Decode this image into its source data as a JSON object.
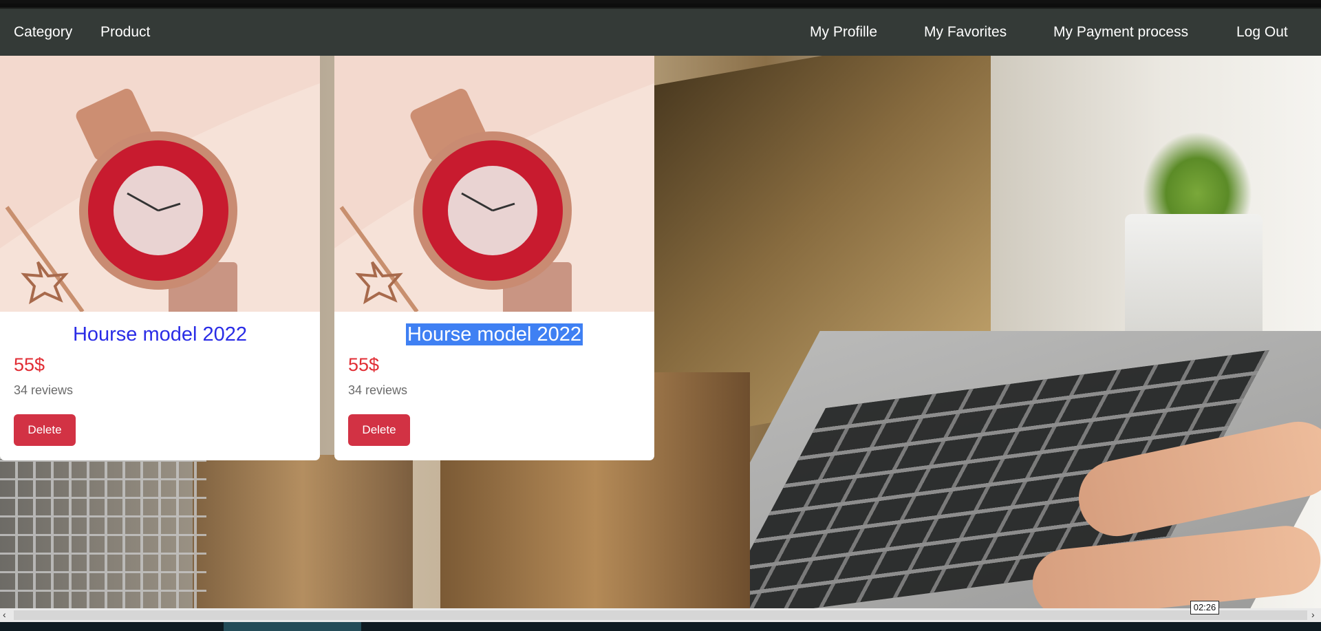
{
  "nav": {
    "left": [
      {
        "label": "Category"
      },
      {
        "label": "Product"
      }
    ],
    "right": [
      {
        "label": "My Profille"
      },
      {
        "label": "My Favorites"
      },
      {
        "label": "My Payment process"
      },
      {
        "label": "Log Out"
      }
    ]
  },
  "products": [
    {
      "title": "Hourse model 2022",
      "price": "55$",
      "reviews": "34 reviews",
      "delete_label": "Delete",
      "title_selected": false
    },
    {
      "title": "Hourse model 2022",
      "price": "55$",
      "reviews": "34 reviews",
      "delete_label": "Delete",
      "title_selected": true
    }
  ],
  "video": {
    "timestamp": "02:26"
  },
  "colors": {
    "navbar": "#343a37",
    "title": "#2a2ce6",
    "price": "#e12d34",
    "delete_button": "#d23244",
    "selection": "#3f80f3"
  }
}
